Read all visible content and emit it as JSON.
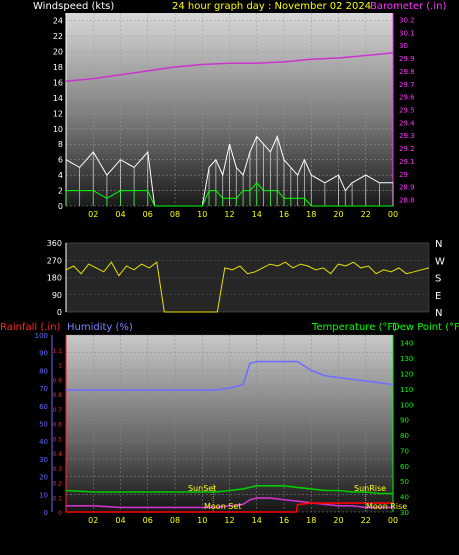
{
  "header": {
    "wind_label": "Windspeed (kts)",
    "title": "24 hour graph day : November 02 2024",
    "baro_label": "Barometer (.in)"
  },
  "bottom_labels": {
    "rain": "Rainfall (.in)",
    "humidity": "Humidity (%)",
    "temp": "Temperature (°F)",
    "dew": "Dew Point (°F)"
  },
  "events": {
    "sunset": "SunSet",
    "sunrise": "SunRise",
    "moonset": "Moon Set",
    "moonrise": "Moon Rise"
  },
  "colors": {
    "wind_gust": "#ffffff",
    "wind_avg": "#00ff00",
    "barometer": "#cc33cc",
    "direction": "#e8e000",
    "humidity": "#7070ff",
    "temperature": "#00cc00",
    "dewpoint": "#cc33cc",
    "rain": "#ff0000",
    "hum_axis": "#6666ff",
    "temp_axis": "#00ff00",
    "rain_axis": "#ff2222",
    "x_ticks": "#ffff00"
  },
  "chart_data": [
    {
      "type": "line",
      "title": "24 hour graph day : November 02 2024",
      "xlabel": "",
      "x_ticks": [
        "02",
        "04",
        "06",
        "08",
        "10",
        "12",
        "14",
        "16",
        "18",
        "20",
        "22",
        "00"
      ],
      "y_left": {
        "label": "Windspeed (kts)",
        "ylim": [
          0,
          25
        ],
        "ticks": [
          "0",
          "2",
          "4",
          "6",
          "8",
          "10",
          "12",
          "14",
          "16",
          "18",
          "20",
          "22",
          "24"
        ]
      },
      "y_right": {
        "label": "Barometer (.in)",
        "ylim": [
          28.75,
          30.25
        ],
        "ticks": [
          "28.8",
          "28.9",
          "29",
          "29.1",
          "29.2",
          "29.3",
          "29.4",
          "29.5",
          "29.6",
          "29.7",
          "29.8",
          "29.9",
          "30",
          "30.1",
          "30.2"
        ]
      },
      "series": [
        {
          "name": "Barometer",
          "axis": "right",
          "x": [
            0,
            2,
            4,
            6,
            8,
            10,
            12,
            14,
            16,
            18,
            20,
            22,
            24
          ],
          "values": [
            29.72,
            29.74,
            29.77,
            29.8,
            29.83,
            29.85,
            29.86,
            29.86,
            29.87,
            29.89,
            29.9,
            29.92,
            29.94
          ]
        },
        {
          "name": "Gust",
          "axis": "left",
          "x": [
            0,
            1,
            2,
            3,
            4,
            5,
            6,
            6.5,
            7,
            8,
            9,
            10,
            10.5,
            11,
            11.5,
            12,
            12.5,
            13,
            13.5,
            14,
            14.5,
            15,
            15.5,
            16,
            16.5,
            17,
            17.5,
            18,
            19,
            20,
            20.5,
            21,
            22,
            23,
            24
          ],
          "values": [
            6,
            5,
            7,
            4,
            6,
            5,
            7,
            0,
            0,
            0,
            0,
            0,
            5,
            6,
            4,
            8,
            5,
            4,
            7,
            9,
            8,
            7,
            9,
            6,
            5,
            4,
            6,
            4,
            3,
            4,
            2,
            3,
            4,
            3,
            3
          ]
        },
        {
          "name": "Average",
          "axis": "left",
          "x": [
            0,
            1,
            2,
            3,
            4,
            5,
            6,
            6.5,
            7,
            8,
            9,
            10,
            10.5,
            11,
            11.5,
            12,
            12.5,
            13,
            13.5,
            14,
            14.5,
            15,
            15.5,
            16,
            16.5,
            17,
            17.5,
            18,
            19,
            20,
            20.5,
            21,
            22,
            23,
            24
          ],
          "values": [
            2,
            2,
            2,
            1,
            2,
            2,
            2,
            0,
            0,
            0,
            0,
            0,
            2,
            2,
            1,
            1,
            1,
            2,
            2,
            3,
            2,
            2,
            2,
            1,
            1,
            1,
            1,
            0,
            0,
            0,
            0,
            0,
            0,
            0,
            0
          ]
        }
      ]
    },
    {
      "type": "scatter",
      "x_ticks": [
        "02",
        "04",
        "06",
        "08",
        "10",
        "12",
        "14",
        "16",
        "18",
        "20",
        "22",
        "00"
      ],
      "y_left": {
        "ylim": [
          0,
          360
        ],
        "ticks": [
          "0",
          "90",
          "180",
          "270",
          "360"
        ]
      },
      "y_right": {
        "ticks": [
          "N",
          "W",
          "S",
          "E",
          "N"
        ]
      },
      "series": [
        {
          "name": "Direction",
          "x": [
            0,
            0.5,
            1,
            1.5,
            2,
            2.5,
            3,
            3.5,
            4,
            4.5,
            5,
            5.5,
            6,
            6.5,
            7,
            8,
            9,
            9.5,
            10,
            10.5,
            11,
            11.5,
            12,
            12.5,
            13,
            13.5,
            14,
            14.5,
            15,
            15.5,
            16,
            16.5,
            17,
            17.5,
            18,
            18.5,
            19,
            19.5,
            20,
            20.5,
            21,
            21.5,
            22,
            22.5,
            23,
            23.5,
            24
          ],
          "values": [
            220,
            240,
            200,
            250,
            230,
            210,
            260,
            190,
            240,
            220,
            250,
            230,
            260,
            0,
            0,
            0,
            0,
            0,
            0,
            230,
            220,
            240,
            200,
            210,
            230,
            250,
            240,
            260,
            230,
            250,
            240,
            220,
            230,
            200,
            250,
            240,
            260,
            230,
            240,
            200,
            220,
            210,
            230,
            200,
            210,
            220,
            230
          ]
        }
      ]
    },
    {
      "type": "line",
      "x_ticks": [
        "02",
        "04",
        "06",
        "08",
        "10",
        "12",
        "14",
        "16",
        "18",
        "20",
        "22",
        "00"
      ],
      "y_left_outer": {
        "label": "Rainfall (.in)",
        "ylim": [
          0,
          1.2
        ],
        "ticks": [
          "0",
          "0.1",
          "0.2",
          "0.3",
          "0.4",
          "0.5",
          "0.6",
          "0.7",
          "0.8",
          "0.9",
          "1",
          "1.1"
        ]
      },
      "y_left_inner": {
        "label": "Humidity (%)",
        "ylim": [
          0,
          100
        ],
        "ticks": [
          "0",
          "10",
          "20",
          "30",
          "40",
          "50",
          "60",
          "70",
          "80",
          "90",
          "100"
        ]
      },
      "y_right": {
        "label": "Temperature (°F)",
        "ylim": [
          30,
          145
        ],
        "ticks": [
          "30",
          "40",
          "50",
          "60",
          "70",
          "80",
          "90",
          "100",
          "110",
          "120",
          "130",
          "140"
        ]
      },
      "series": [
        {
          "name": "Humidity",
          "axis": "humidity",
          "x": [
            0,
            2,
            4,
            6,
            8,
            10,
            11,
            12,
            13,
            13.5,
            14,
            15,
            16,
            17,
            18,
            19,
            20,
            21,
            22,
            23,
            24
          ],
          "values": [
            69,
            69,
            69,
            69,
            69,
            69,
            69,
            70,
            72,
            84,
            85,
            85,
            85,
            85,
            80,
            77,
            76,
            75,
            74,
            73,
            72
          ]
        },
        {
          "name": "Temperature",
          "axis": "right",
          "x": [
            0,
            2,
            4,
            6,
            8,
            10,
            11,
            12,
            13,
            14,
            15,
            16,
            17,
            18,
            19,
            20,
            21,
            22,
            23,
            24
          ],
          "values": [
            44,
            43,
            43,
            43,
            43,
            43,
            43,
            44,
            45,
            47,
            47,
            47,
            46,
            45,
            44,
            44,
            43,
            43,
            42,
            42
          ]
        },
        {
          "name": "Dew Point",
          "axis": "right",
          "x": [
            0,
            2,
            4,
            6,
            8,
            10,
            11,
            12,
            13,
            13.5,
            14,
            15,
            16,
            17,
            18,
            19,
            20,
            21,
            22,
            23,
            24
          ],
          "values": [
            34,
            34,
            33,
            33,
            33,
            33,
            33,
            34,
            35,
            38,
            39,
            39,
            38,
            37,
            36,
            35,
            34,
            34,
            33,
            33,
            33
          ]
        },
        {
          "name": "Rainfall",
          "axis": "rain",
          "x": [
            0,
            4,
            8,
            12,
            16,
            16.9,
            17,
            18,
            20,
            22,
            24
          ],
          "values": [
            0,
            0,
            0,
            0,
            0,
            0,
            0.05,
            0.06,
            0.06,
            0.06,
            0.06
          ]
        }
      ]
    }
  ]
}
